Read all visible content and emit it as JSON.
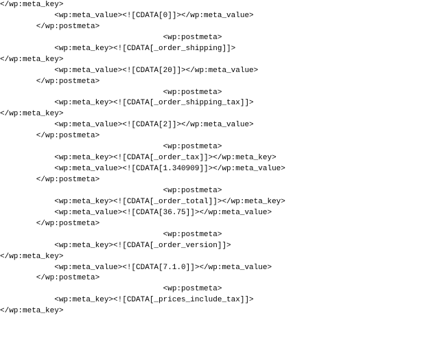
{
  "code_lines": [
    "</wp:meta_key>",
    "            <wp:meta_value><![CDATA[0]]></wp:meta_value>",
    "        </wp:postmeta>",
    "                                    <wp:postmeta>",
    "            <wp:meta_key><![CDATA[_order_shipping]]>",
    "</wp:meta_key>",
    "            <wp:meta_value><![CDATA[20]]></wp:meta_value>",
    "        </wp:postmeta>",
    "                                    <wp:postmeta>",
    "            <wp:meta_key><![CDATA[_order_shipping_tax]]>",
    "</wp:meta_key>",
    "            <wp:meta_value><![CDATA[2]]></wp:meta_value>",
    "        </wp:postmeta>",
    "                                    <wp:postmeta>",
    "            <wp:meta_key><![CDATA[_order_tax]]></wp:meta_key>",
    "            <wp:meta_value><![CDATA[1.340909]]></wp:meta_value>",
    "        </wp:postmeta>",
    "                                    <wp:postmeta>",
    "            <wp:meta_key><![CDATA[_order_total]]></wp:meta_key>",
    "            <wp:meta_value><![CDATA[36.75]]></wp:meta_value>",
    "        </wp:postmeta>",
    "                                    <wp:postmeta>",
    "            <wp:meta_key><![CDATA[_order_version]]>",
    "</wp:meta_key>",
    "            <wp:meta_value><![CDATA[7.1.0]]></wp:meta_value>",
    "        </wp:postmeta>",
    "                                    <wp:postmeta>",
    "            <wp:meta_key><![CDATA[_prices_include_tax]]>",
    "</wp:meta_key>"
  ]
}
